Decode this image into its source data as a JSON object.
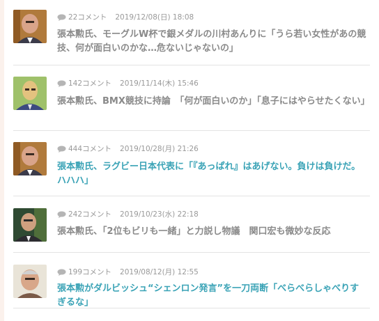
{
  "articles": [
    {
      "comments": "22コメント",
      "date": "2019/12/08(日) 18:08",
      "title": "張本勲氏、モーグルW杯で銀メダルの川村あんりに「うら若い女性があの競技、何が面白いのかな…危ないじゃないの」",
      "visited": true
    },
    {
      "comments": "142コメント",
      "date": "2019/11/14(木) 15:46",
      "title": "張本勲氏、BMX競技に持論　「何が面白いのか」「息子にはやらせたくない」",
      "visited": true
    },
    {
      "comments": "444コメント",
      "date": "2019/10/28(月) 21:26",
      "title": "張本勲氏、ラグビー日本代表に「『あっぱれ』はあげない。負けは負けだ。ハハハ」",
      "visited": false
    },
    {
      "comments": "242コメント",
      "date": "2019/10/23(水) 22:18",
      "title": "張本勲氏、「2位もビリも一緒」と力説し物議　関口宏も微妙な反応",
      "visited": true
    },
    {
      "comments": "199コメント",
      "date": "2019/08/12(月) 12:55",
      "title": "張本勲がダルビッシュ“シェンロン発言”を一刀両断「べらべらしゃべりすぎるな」",
      "visited": false
    }
  ],
  "colors": {
    "visited_link": "#8a8a8a",
    "link": "#3aa3b6",
    "meta": "#999999",
    "divider": "#e3e3e3"
  }
}
